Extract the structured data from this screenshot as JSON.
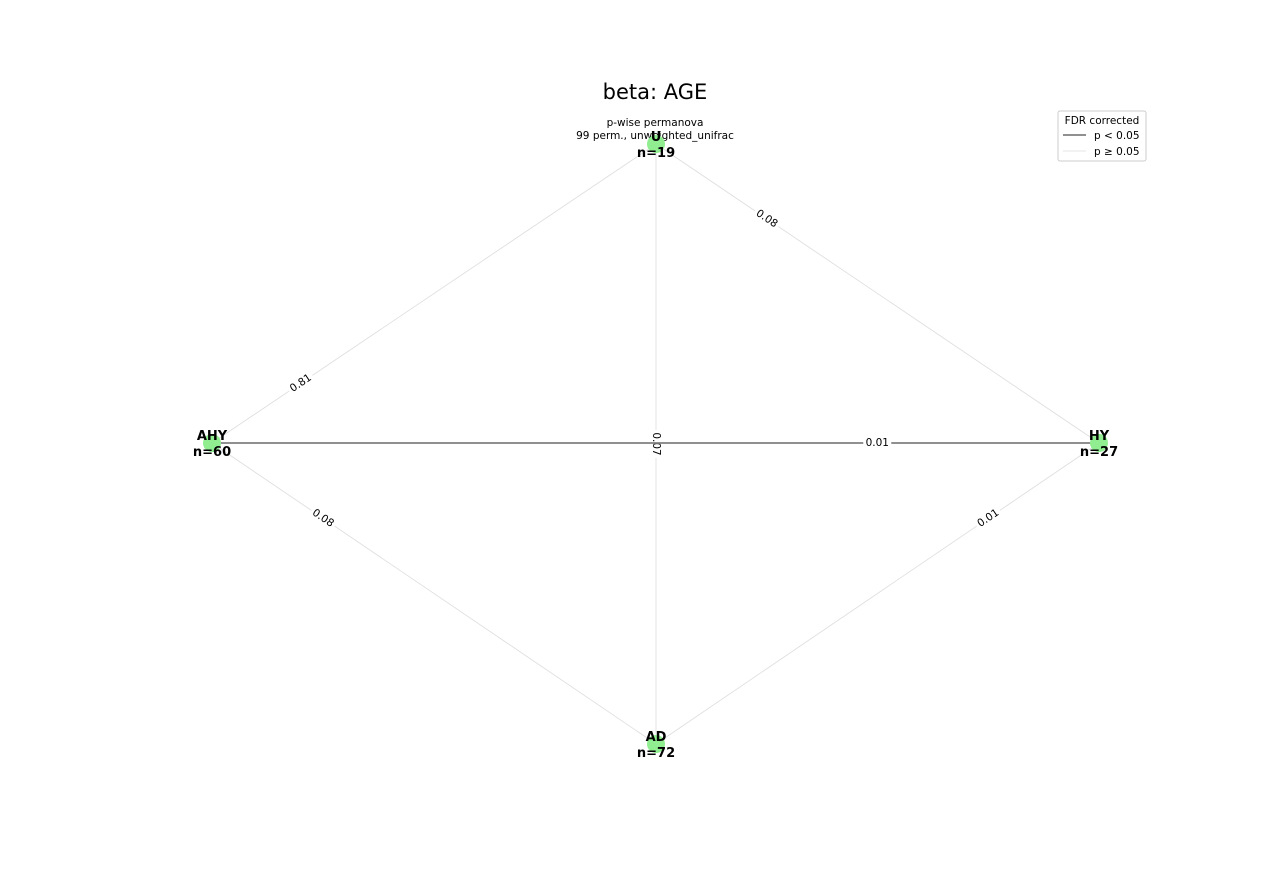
{
  "title": "beta: AGE",
  "subtitle": [
    "p-wise permanova",
    "99 perm., unweighted_unifrac"
  ],
  "colors": {
    "node": "#90ee90",
    "significant_edge": "#808080",
    "nonsignificant_edge": "#dcdcdc",
    "legend_border": "#cccccc"
  },
  "legend": {
    "title": "FDR corrected",
    "items": [
      {
        "label": "p < 0.05",
        "style": "significant"
      },
      {
        "label": "p ≥ 0.05",
        "style": "nonsignificant"
      }
    ]
  },
  "nodes": [
    {
      "id": "U",
      "name": "U",
      "n_label": "n=19"
    },
    {
      "id": "AHY",
      "name": "AHY",
      "n_label": "n=60"
    },
    {
      "id": "HY",
      "name": "HY",
      "n_label": "n=27"
    },
    {
      "id": "AD",
      "name": "AD",
      "n_label": "n=72"
    }
  ],
  "edges": [
    {
      "source": "U",
      "target": "AHY",
      "label": "0.81",
      "significant": false
    },
    {
      "source": "U",
      "target": "HY",
      "label": "0.08",
      "significant": false
    },
    {
      "source": "U",
      "target": "AD",
      "label": "0.07",
      "significant": false
    },
    {
      "source": "AHY",
      "target": "HY",
      "label": "0.01",
      "significant": true
    },
    {
      "source": "AHY",
      "target": "AD",
      "label": "0.08",
      "significant": false
    },
    {
      "source": "HY",
      "target": "AD",
      "label": "0.01",
      "significant": false
    }
  ]
}
